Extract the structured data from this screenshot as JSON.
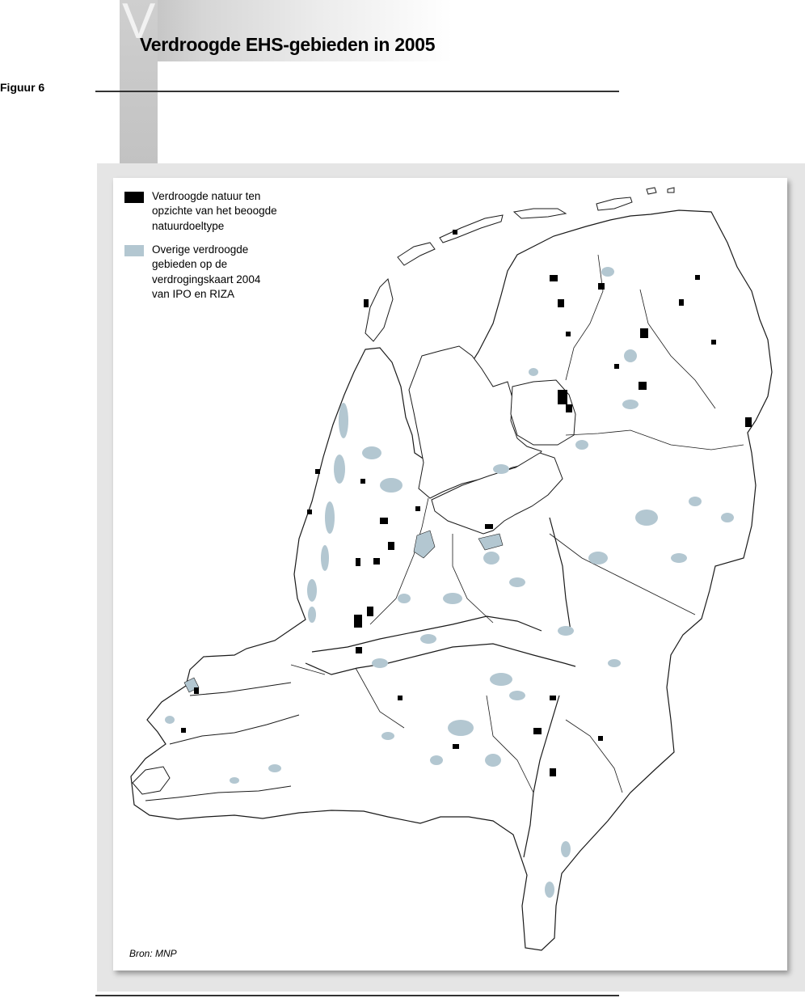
{
  "header": {
    "letter": "V",
    "title": "Verdroogde EHS-gebieden in 2005",
    "figure_label": "Figuur 6"
  },
  "legend": [
    {
      "label": "Verdroogde natuur ten\nopzichte van het beoogde\nnatuurdoeltype",
      "color": "#000000"
    },
    {
      "label": "Overige verdroogde\ngebieden op de\nverdrogingskaart 2004\nvan IPO en RIZA",
      "color": "#b3c7d1"
    }
  ],
  "source": "Bron: MNP",
  "colors": {
    "outline": "#1a1a1a",
    "land": "#ffffff",
    "frame": "#e5e5e5",
    "gray_band": "#c6c6c6"
  }
}
